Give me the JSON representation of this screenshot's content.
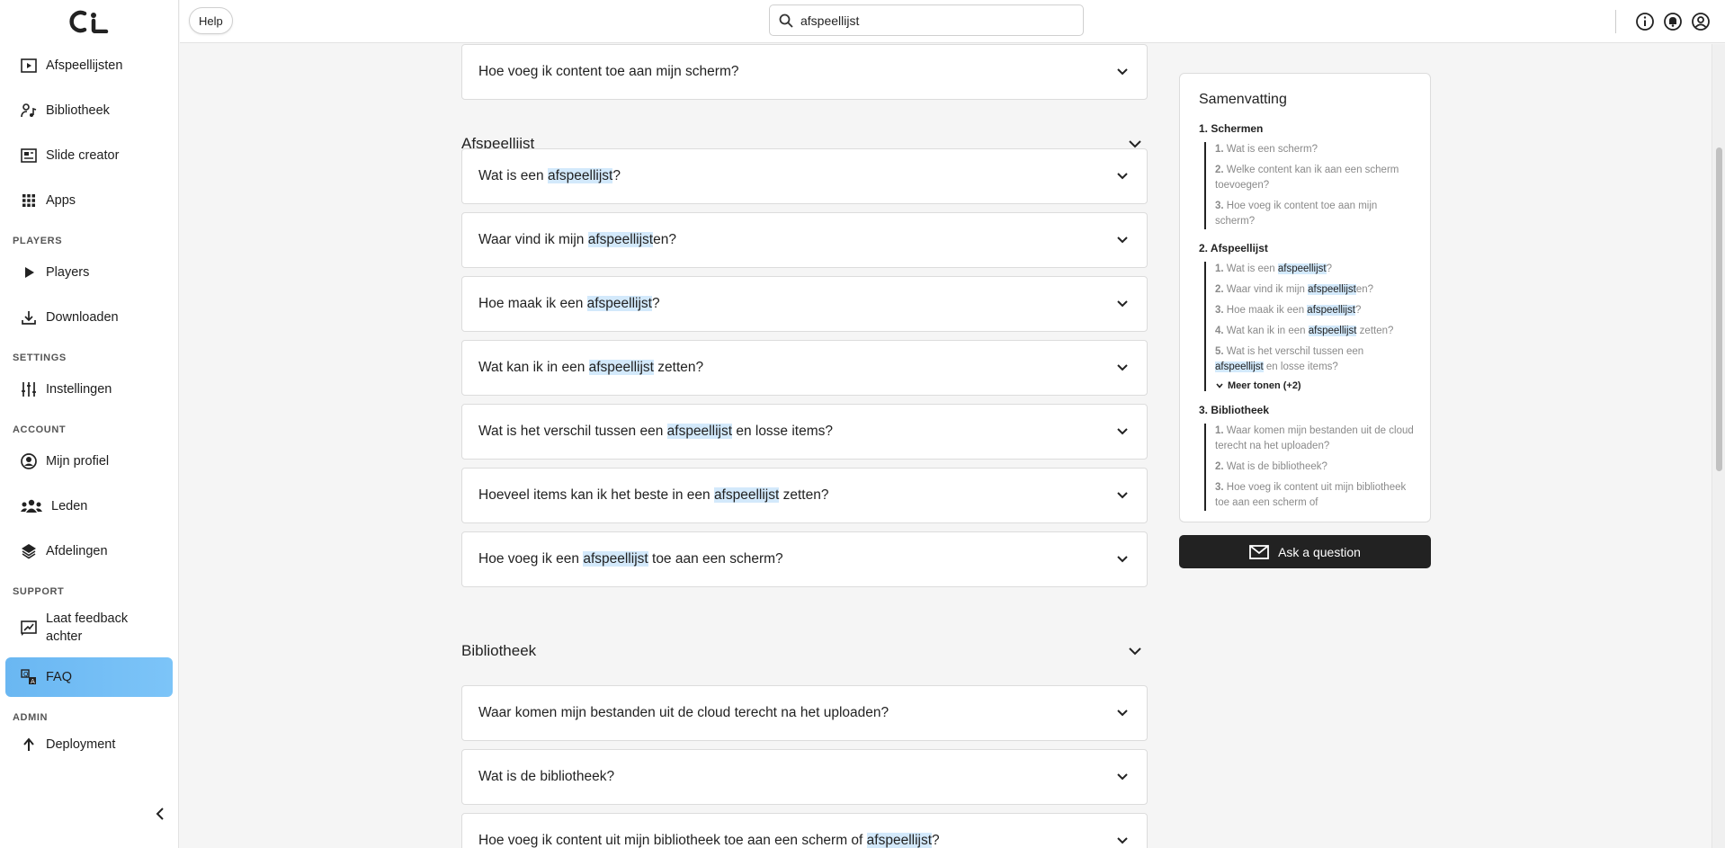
{
  "sidebar": {
    "items_top": [
      {
        "label": "Afspeellijsten",
        "icon": "playlist-icon"
      },
      {
        "label": "Bibliotheek",
        "icon": "library-icon"
      },
      {
        "label": "Slide creator",
        "icon": "slide-icon"
      },
      {
        "label": "Apps",
        "icon": "apps-grid-icon"
      }
    ],
    "sections": {
      "players": "PLAYERS",
      "settings": "SETTINGS",
      "account": "ACCOUNT",
      "support": "SUPPORT",
      "admin": "ADMIN"
    },
    "players_items": [
      {
        "label": "Players",
        "icon": "play-icon"
      },
      {
        "label": "Downloaden",
        "icon": "download-icon"
      }
    ],
    "settings_items": [
      {
        "label": "Instellingen",
        "icon": "sliders-icon"
      }
    ],
    "account_items": [
      {
        "label": "Mijn profiel",
        "icon": "profile-icon"
      },
      {
        "label": "Leden",
        "icon": "members-icon"
      },
      {
        "label": "Afdelingen",
        "icon": "layers-icon"
      }
    ],
    "support_items": [
      {
        "label": "Laat feedback achter",
        "icon": "feedback-icon"
      },
      {
        "label": "FAQ",
        "icon": "faq-icon",
        "active": true
      }
    ],
    "admin_items": [
      {
        "label": "Deployment",
        "icon": "upload-arrow-icon"
      }
    ]
  },
  "topbar": {
    "help_label": "Help",
    "search_value": "afspeellijst"
  },
  "faq": {
    "top_question": "Hoe voeg ik content toe aan mijn scherm?",
    "section_playlist": "Afspeellijst",
    "playlist_questions": [
      [
        "Wat is een ",
        "afspeellijst",
        "?"
      ],
      [
        "Waar vind ik mijn ",
        "afspeellijst",
        "en?"
      ],
      [
        "Hoe maak ik een ",
        "afspeellijst",
        "?"
      ],
      [
        "Wat kan ik in een ",
        "afspeellijst",
        " zetten?"
      ],
      [
        "Wat is het verschil tussen een ",
        "afspeellijst",
        " en losse items?"
      ],
      [
        "Hoeveel items kan ik het beste in een ",
        "afspeellijst",
        " zetten?"
      ],
      [
        "Hoe voeg ik een ",
        "afspeellijst",
        " toe aan een scherm?"
      ]
    ],
    "section_library": "Bibliotheek",
    "library_questions": [
      [
        "Waar komen mijn bestanden uit de cloud terecht na het uploaden?",
        "",
        ""
      ],
      [
        "Wat is de bibliotheek?",
        "",
        ""
      ],
      [
        "Hoe voeg ik content uit mijn bibliotheek toe aan een scherm of ",
        "afspeellijst",
        "?"
      ]
    ]
  },
  "summary": {
    "title": "Samenvatting",
    "sections": [
      {
        "label": "1. Schermen",
        "items": [
          [
            "1.",
            "Wat is een scherm?",
            "",
            ""
          ],
          [
            "2.",
            "Welke content kan ik aan een scherm toevoegen?",
            "",
            ""
          ],
          [
            "3.",
            "Hoe voeg ik content toe aan mijn scherm?",
            "",
            ""
          ]
        ]
      },
      {
        "label": "2. Afspeellijst",
        "items": [
          [
            "1.",
            "Wat is een ",
            "afspeellijst",
            "?"
          ],
          [
            "2.",
            "Waar vind ik mijn ",
            "afspeellijst",
            "en?"
          ],
          [
            "3.",
            "Hoe maak ik een ",
            "afspeellijst",
            "?"
          ],
          [
            "4.",
            "Wat kan ik in een ",
            "afspeellijst",
            " zetten?"
          ],
          [
            "5.",
            "Wat is het verschil tussen een ",
            "afspeellijst",
            " en losse items?"
          ]
        ],
        "more": "Meer tonen (+2)"
      },
      {
        "label": "3. Bibliotheek",
        "items": [
          [
            "1.",
            "Waar komen mijn bestanden uit de cloud terecht na het uploaden?",
            "",
            ""
          ],
          [
            "2.",
            "Wat is de bibliotheek?",
            "",
            ""
          ],
          [
            "3.",
            "Hoe voeg ik content uit mijn bibliotheek toe aan een scherm of",
            "",
            ""
          ]
        ]
      }
    ]
  },
  "ask_button": "Ask a question",
  "colors": {
    "active_nav": "#6ab7f2",
    "highlight": "#d3e9fb",
    "dark_button": "#222222"
  }
}
